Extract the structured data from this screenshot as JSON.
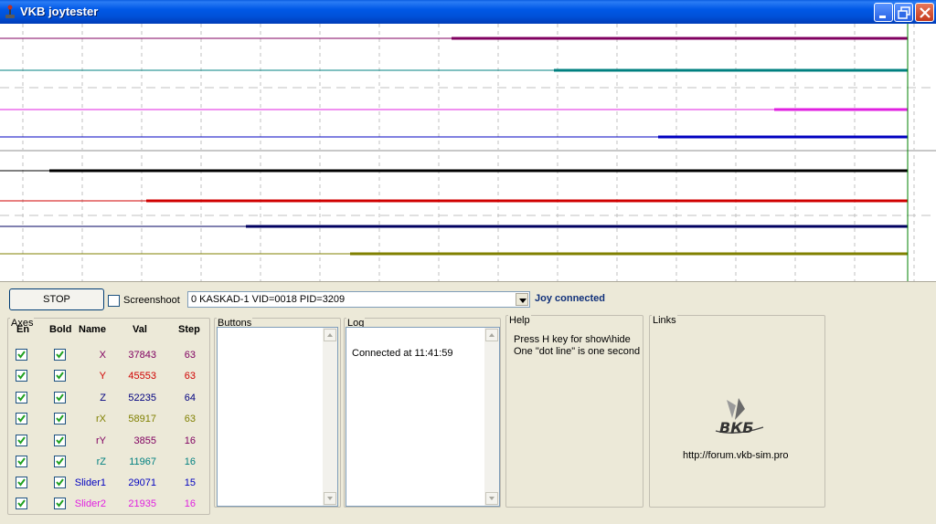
{
  "window": {
    "title": "VKB joytester",
    "icon": "joystick-icon",
    "minimize_icon": "minimize-icon",
    "maximize_icon": "maximize-icon",
    "close_icon": "close-icon"
  },
  "graph": {
    "traces": [
      {
        "color": "#800060"
      },
      {
        "color": "#008080"
      },
      {
        "color": "#e020e0"
      },
      {
        "color": "#0000c0"
      },
      {
        "color": "#000000"
      },
      {
        "color": "#d00000"
      },
      {
        "color": "#000060"
      },
      {
        "color": "#808000"
      }
    ]
  },
  "toolbar": {
    "stop_label": "STOP",
    "screenshot_label": "Screenshoot",
    "screenshot_checked": false,
    "device_value": "0 KASKAD-1 VID=0018 PID=3209",
    "status": "Joy connected"
  },
  "axes": {
    "title": "Axes",
    "headers": {
      "en": "En",
      "bold": "Bold",
      "name": "Name",
      "val": "Val",
      "step": "Step"
    },
    "rows": [
      {
        "name": "X",
        "val": "37843",
        "step": "63",
        "color": "#800060",
        "en": true,
        "bold": true
      },
      {
        "name": "Y",
        "val": "45553",
        "step": "63",
        "color": "#d00000",
        "en": true,
        "bold": true
      },
      {
        "name": "Z",
        "val": "52235",
        "step": "64",
        "color": "#000080",
        "en": true,
        "bold": true
      },
      {
        "name": "rX",
        "val": "58917",
        "step": "63",
        "color": "#808000",
        "en": true,
        "bold": true
      },
      {
        "name": "rY",
        "val": "3855",
        "step": "16",
        "color": "#800060",
        "en": true,
        "bold": true
      },
      {
        "name": "rZ",
        "val": "11967",
        "step": "16",
        "color": "#008080",
        "en": true,
        "bold": true
      },
      {
        "name": "Slider1",
        "val": "29071",
        "step": "15",
        "color": "#0000c0",
        "en": true,
        "bold": true
      },
      {
        "name": "Slider2",
        "val": "21935",
        "step": "16",
        "color": "#e020e0",
        "en": true,
        "bold": true
      }
    ]
  },
  "buttons_group": {
    "title": "Buttons"
  },
  "log": {
    "title": "Log",
    "text": "Connected at 11:41:59"
  },
  "help": {
    "title": "Help",
    "line1": "Press H key for show\\hide",
    "line2": "One \"dot line\" is one second"
  },
  "links": {
    "title": "Links",
    "url": "http://forum.vkb-sim.pro",
    "logo_text": "ВКБ"
  }
}
